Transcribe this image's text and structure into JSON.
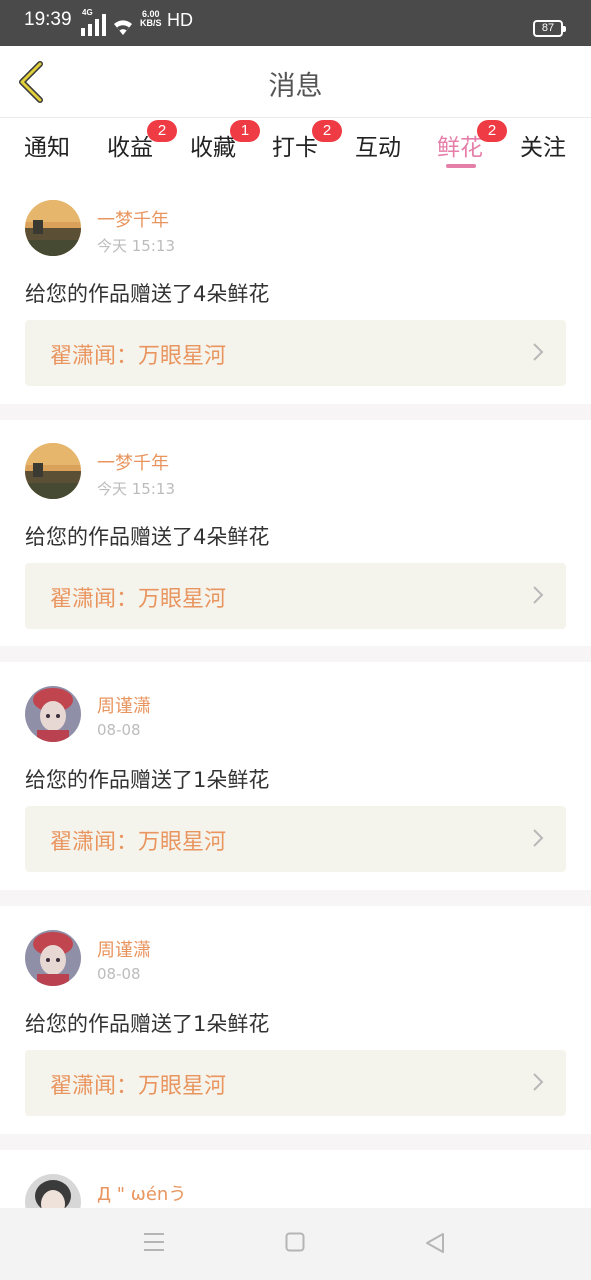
{
  "status_bar": {
    "time": "19:39",
    "network": "4G",
    "speed_value": "6.00",
    "speed_unit": "KB/S",
    "hd": "HD",
    "battery": "87"
  },
  "header": {
    "title": "消息",
    "back_icon": "chevron-left-icon",
    "back_color": "#d9c22b"
  },
  "tabs": [
    {
      "label": "通知",
      "badge": ""
    },
    {
      "label": "收益",
      "badge": "2"
    },
    {
      "label": "收藏",
      "badge": "1"
    },
    {
      "label": "打卡",
      "badge": "2"
    },
    {
      "label": "互动",
      "badge": ""
    },
    {
      "label": "鲜花",
      "badge": "2",
      "active": true
    },
    {
      "label": "关注",
      "badge": ""
    }
  ],
  "messages": [
    {
      "user": "一梦千年",
      "time": "今天 15:13",
      "text": "给您的作品赠送了4朵鲜花",
      "work": "翟潇闻：万眼星河"
    },
    {
      "user": "一梦千年",
      "time": "今天 15:13",
      "text": "给您的作品赠送了4朵鲜花",
      "work": "翟潇闻：万眼星河"
    },
    {
      "user": "周谨潇",
      "time": "08-08",
      "text": "给您的作品赠送了1朵鲜花",
      "work": "翟潇闻：万眼星河"
    },
    {
      "user": "周谨潇",
      "time": "08-08",
      "text": "给您的作品赠送了1朵鲜花",
      "work": "翟潇闻：万眼星河"
    },
    {
      "user": "Д \" ωénう",
      "time": "",
      "text": "",
      "work": ""
    }
  ],
  "colors": {
    "accent_pink": "#e57ea8",
    "username_orange": "#e9955f",
    "badge_red": "#ee3b44",
    "work_bg": "#f5f4ec"
  },
  "nav": {
    "menu_icon": "menu-icon",
    "home_icon": "square-home-icon",
    "back_icon": "triangle-back-icon"
  }
}
